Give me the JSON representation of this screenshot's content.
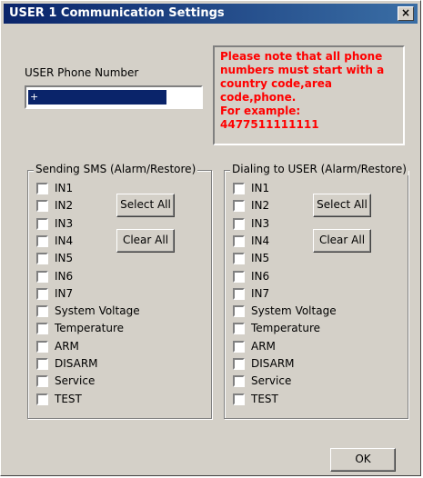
{
  "window": {
    "title": "USER 1 Communication Settings",
    "close_label": "×"
  },
  "phone": {
    "label": "USER Phone Number",
    "value": "+"
  },
  "note": {
    "lines": [
      "Please note that all phone",
      "numbers must  start with a",
      "country code,area",
      "code,phone.",
      "For example:",
      "4477511111111"
    ]
  },
  "groups": [
    {
      "title": "Sending SMS (Alarm/Restore)",
      "select_all": "Select All",
      "clear_all": "Clear All",
      "items": [
        "IN1",
        "IN2",
        "IN3",
        "IN4",
        "IN5",
        "IN6",
        "IN7",
        "System Voltage",
        "Temperature",
        "ARM",
        "DISARM",
        "Service",
        "TEST"
      ]
    },
    {
      "title": "Dialing to USER (Alarm/Restore)",
      "select_all": "Select All",
      "clear_all": "Clear All",
      "items": [
        "IN1",
        "IN2",
        "IN3",
        "IN4",
        "IN5",
        "IN6",
        "IN7",
        "System Voltage",
        "Temperature",
        "ARM",
        "DISARM",
        "Service",
        "TEST"
      ]
    }
  ],
  "footer": {
    "ok_label": "OK"
  },
  "colors": {
    "titlebar": "#0a246a",
    "note_text": "#ff0000",
    "dialog_bg": "#d4d0c8"
  }
}
